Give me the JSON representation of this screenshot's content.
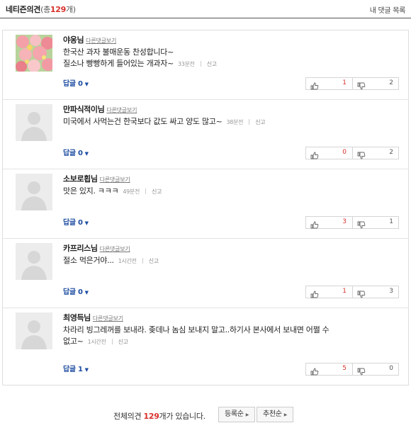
{
  "header": {
    "title": "네티즌의견",
    "count_prefix": "(총",
    "count": "129",
    "count_suffix": "개)",
    "my_comments_link": "내 댓글 목록"
  },
  "comment_common": {
    "other_comments_link": "다른댓글보기",
    "report_label": "신고",
    "reply_label": "답글",
    "reply_arrow": "▼"
  },
  "comments": [
    {
      "nickname": "야옹님",
      "text_lines": [
        "한국산 과자 불매운동 찬성합니다~",
        "질소나 빵빵하게 들어있는 개과자~"
      ],
      "time": "33분전",
      "replies": "0",
      "up": "1",
      "down": "2",
      "avatar": "flowers"
    },
    {
      "nickname": "만파식적이님",
      "text_lines": [
        "미국에서 사먹는건 한국보다 값도 싸고 양도 많고~"
      ],
      "time": "38분전",
      "replies": "0",
      "up": "0",
      "down": "2",
      "avatar": "default"
    },
    {
      "nickname": "소보로횝님",
      "text_lines": [
        "맛은 있지. ㅋㅋㅋ"
      ],
      "time": "49분전",
      "replies": "0",
      "up": "3",
      "down": "1",
      "avatar": "default"
    },
    {
      "nickname": "카프리스님",
      "text_lines": [
        "절소 먹은거야..."
      ],
      "time": "1시간전",
      "replies": "0",
      "up": "1",
      "down": "3",
      "avatar": "default"
    },
    {
      "nickname": "최영득님",
      "text_lines": [
        "차라리 빙그레꺼를 보내라. 좆데나 놈심 보내지 말고..하기사 본사에서 보내면 어쩔 수",
        "없고~"
      ],
      "time": "1시간전",
      "replies": "1",
      "up": "5",
      "down": "0",
      "avatar": "default"
    }
  ],
  "footer": {
    "total_prefix": "전체의견",
    "total_count": "129",
    "total_suffix": "개가 있습니다.",
    "sort_latest": "등록순",
    "sort_recommend": "추천순",
    "sort_arrow": "▶"
  },
  "colors": {
    "accent_red": "#d9302a",
    "reply_blue": "#1e4da1"
  }
}
